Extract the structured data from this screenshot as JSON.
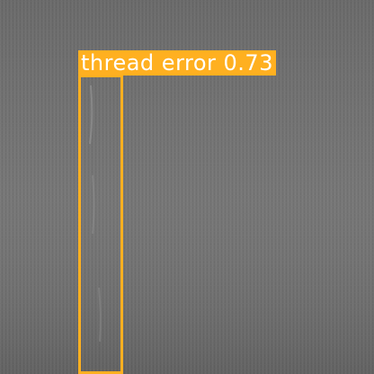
{
  "detection": {
    "class": "thread error",
    "confidence": "0.73",
    "label": "thread error 0.73",
    "box_color": "#ffb020"
  },
  "scene": {
    "subject": "grey woven fabric with a vertical thread defect"
  }
}
